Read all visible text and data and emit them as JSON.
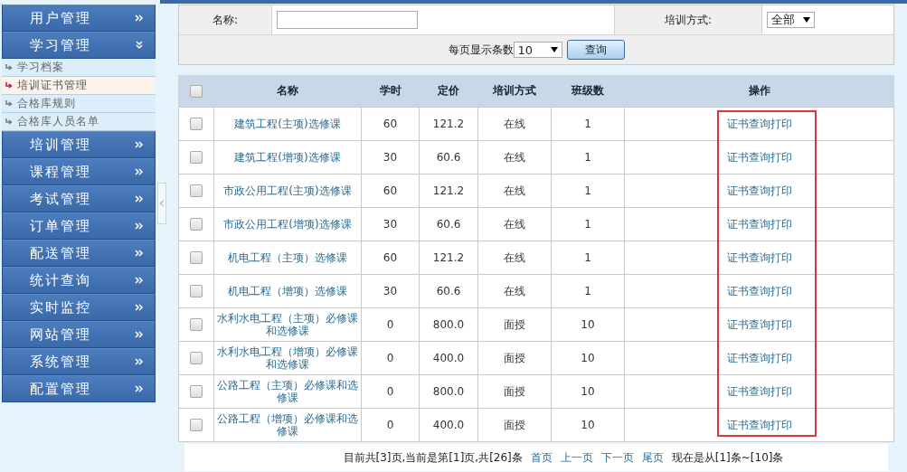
{
  "sidebar": {
    "menus": [
      {
        "label": "用户管理",
        "expanded": false
      },
      {
        "label": "学习管理",
        "expanded": true,
        "children": [
          {
            "label": "学习档案",
            "selected": false
          },
          {
            "label": "培训证书管理",
            "selected": true
          },
          {
            "label": "合格库规则",
            "selected": false
          },
          {
            "label": "合格库人员名单",
            "selected": false
          }
        ]
      },
      {
        "label": "培训管理",
        "expanded": false
      },
      {
        "label": "课程管理",
        "expanded": false
      },
      {
        "label": "考试管理",
        "expanded": false
      },
      {
        "label": "订单管理",
        "expanded": false
      },
      {
        "label": "配送管理",
        "expanded": false
      },
      {
        "label": "统计查询",
        "expanded": false
      },
      {
        "label": "实时监控",
        "expanded": false
      },
      {
        "label": "网站管理",
        "expanded": false
      },
      {
        "label": "系统管理",
        "expanded": false
      },
      {
        "label": "配置管理",
        "expanded": false
      }
    ]
  },
  "filter": {
    "name_label": "名称:",
    "training_label": "培训方式:",
    "training_value": "全部",
    "page_size_label": "每页显示条数",
    "page_size_value": "10",
    "query_button": "查询"
  },
  "table": {
    "select_all_checked": false,
    "columns": [
      "名称",
      "学时",
      "定价",
      "培训方式",
      "班级数",
      "操作"
    ],
    "rows": [
      {
        "checked": false,
        "name": "建筑工程(主项)选修课",
        "hours": "60",
        "price": "121.2",
        "mode": "在线",
        "classes": "1",
        "action": "证书查询打印"
      },
      {
        "checked": false,
        "name": "建筑工程(增项)选修课",
        "hours": "30",
        "price": "60.6",
        "mode": "在线",
        "classes": "1",
        "action": "证书查询打印"
      },
      {
        "checked": false,
        "name": "市政公用工程(主项)选修课",
        "hours": "60",
        "price": "121.2",
        "mode": "在线",
        "classes": "1",
        "action": "证书查询打印"
      },
      {
        "checked": false,
        "name": "市政公用工程(增项)选修课",
        "hours": "30",
        "price": "60.6",
        "mode": "在线",
        "classes": "1",
        "action": "证书查询打印"
      },
      {
        "checked": false,
        "name": "机电工程（主项）选修课",
        "hours": "60",
        "price": "121.2",
        "mode": "在线",
        "classes": "1",
        "action": "证书查询打印"
      },
      {
        "checked": false,
        "name": "机电工程（增项）选修课",
        "hours": "30",
        "price": "60.6",
        "mode": "在线",
        "classes": "1",
        "action": "证书查询打印"
      },
      {
        "checked": false,
        "name": "水利水电工程（主项）必修课和选修课",
        "hours": "0",
        "price": "800.0",
        "mode": "面授",
        "classes": "10",
        "action": "证书查询打印"
      },
      {
        "checked": false,
        "name": "水利水电工程（增项）必修课和选修课",
        "hours": "0",
        "price": "400.0",
        "mode": "面授",
        "classes": "10",
        "action": "证书查询打印"
      },
      {
        "checked": false,
        "name": "公路工程（主项）必修课和选修课",
        "hours": "0",
        "price": "800.0",
        "mode": "面授",
        "classes": "10",
        "action": "证书查询打印"
      },
      {
        "checked": false,
        "name": "公路工程（增项）必修课和选修课",
        "hours": "0",
        "price": "400.0",
        "mode": "面授",
        "classes": "10",
        "action": "证书查询打印"
      }
    ]
  },
  "pagination": {
    "summary": "目前共[3]页,当前是第[1]页,共[26]条",
    "links": [
      "首页",
      "上一页",
      "下一页",
      "尾页"
    ],
    "range": "现在是从[1]条~[10]条"
  }
}
